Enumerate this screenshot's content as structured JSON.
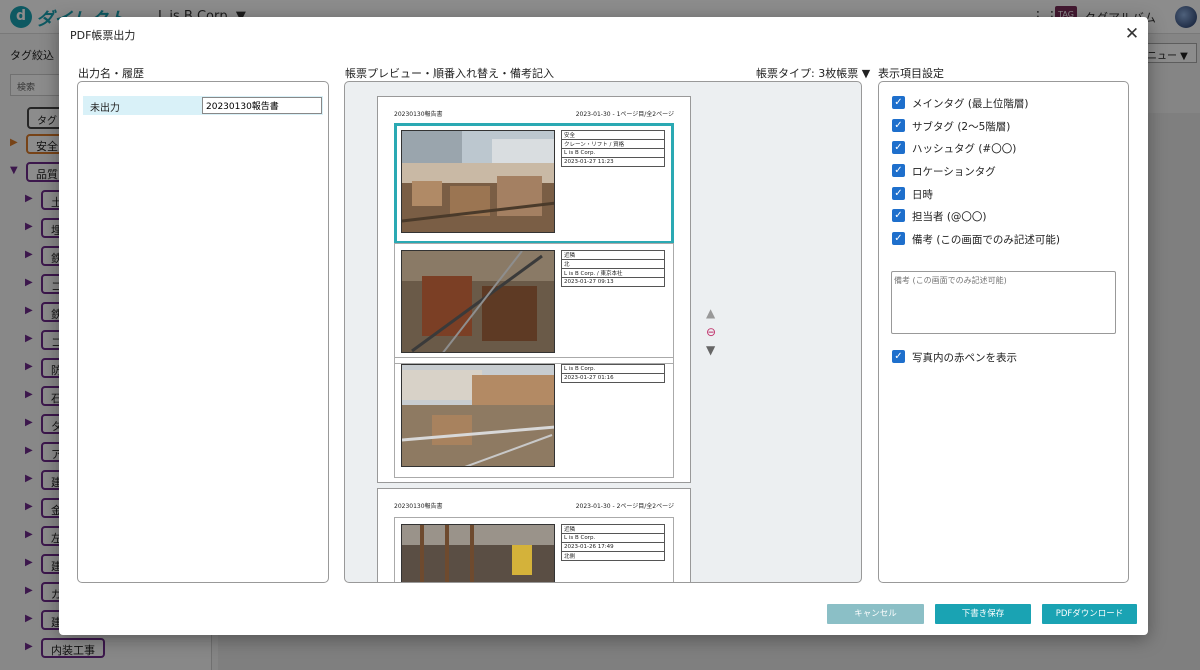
{
  "background": {
    "brand": "ダイレクト",
    "company": "L is B Corp. ▼",
    "tag_icon": "TAG",
    "album_label": "タグアルバム",
    "sidebar_title": "タグ絞込",
    "search_placeholder": "検索",
    "tag_all": "タグ",
    "menu_label": "ニュー ▼",
    "tags": [
      "安全",
      "品質",
      "土",
      "埋",
      "鉄",
      "コ",
      "鉄",
      "コ",
      "防",
      "石",
      "タ",
      "ア",
      "建",
      "金",
      "左",
      "建",
      "ガ",
      "建",
      "内装工事"
    ]
  },
  "modal": {
    "title": "PDF帳票出力",
    "close_icon": "✕",
    "history": {
      "label": "出力名・履歴",
      "status": "未出力",
      "name_value": "20230130報告書"
    },
    "preview": {
      "label": "帳票プレビュー・順番入れ替え・備考記入",
      "type_select": "帳票タイプ: 3枚帳票 ▼",
      "controls": {
        "up": "▲",
        "remove": "⊖",
        "down": "▼"
      },
      "pages": [
        {
          "title": "20230130報告書",
          "info": "2023-01-30 - 1ページ目/全2ページ",
          "entries": [
            {
              "tags": [
                "安全",
                "クレーン・リフト / 資格",
                "L is B Corp.",
                "2023-01-27 11:23"
              ]
            },
            {
              "tags": [
                "近隣",
                "北",
                "L is B Corp. / 東京本社",
                "2023-01-27 09:13"
              ]
            },
            {
              "tags": [
                "L is B Corp.",
                "2023-01-27 01:16"
              ]
            }
          ]
        },
        {
          "title": "20230130報告書",
          "info": "2023-01-30 - 2ページ目/全2ページ",
          "entries": [
            {
              "tags": [
                "近隣",
                "L is B Corp.",
                "2023-01-26 17:49",
                "北側"
              ]
            }
          ]
        }
      ]
    },
    "settings": {
      "label": "表示項目設定",
      "options": [
        "メインタグ (最上位階層)",
        "サブタグ (2〜5階層)",
        "ハッシュタグ (#〇〇)",
        "ロケーションタグ",
        "日時",
        "担当者 (@〇〇)",
        "備考 (この画面でのみ記述可能)"
      ],
      "note_placeholder": "備考 (この画面でのみ記述可能)",
      "redpen_option": "写真内の赤ペンを表示"
    },
    "buttons": {
      "cancel": "キャンセル",
      "draft": "下書き保存",
      "pdf": "PDFダウンロード"
    }
  }
}
